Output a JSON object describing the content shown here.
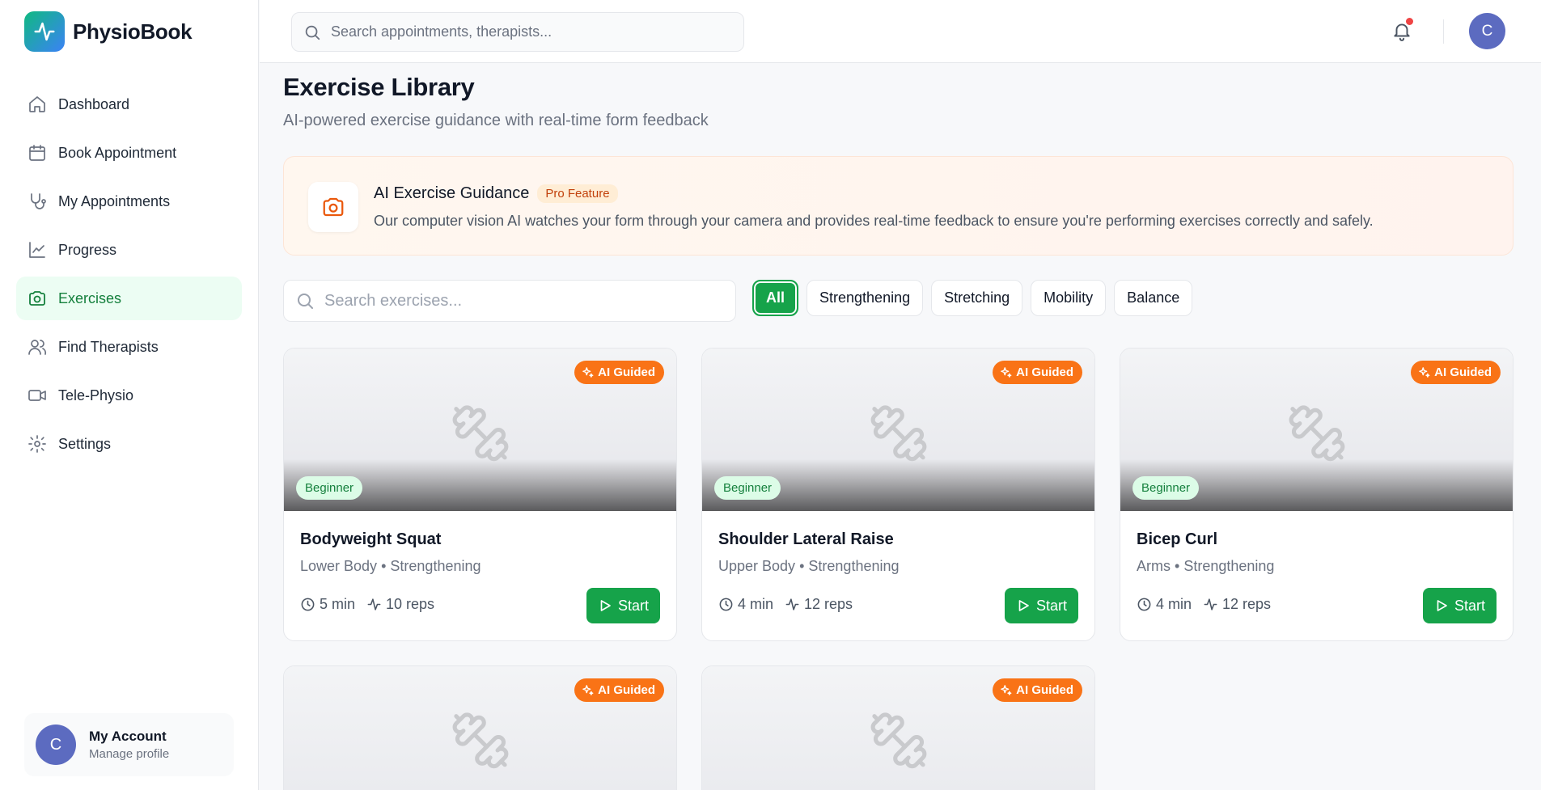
{
  "app": {
    "name": "PhysioBook"
  },
  "sidebar": {
    "items": [
      {
        "label": "Dashboard",
        "icon": "home-icon"
      },
      {
        "label": "Book Appointment",
        "icon": "calendar-icon"
      },
      {
        "label": "My Appointments",
        "icon": "stethoscope-icon"
      },
      {
        "label": "Progress",
        "icon": "chart-line-icon"
      },
      {
        "label": "Exercises",
        "icon": "camera-icon",
        "active": true
      },
      {
        "label": "Find Therapists",
        "icon": "users-icon"
      },
      {
        "label": "Tele-Physio",
        "icon": "video-icon"
      },
      {
        "label": "Settings",
        "icon": "gear-icon"
      }
    ],
    "account": {
      "initial": "C",
      "name": "My Account",
      "sub": "Manage profile"
    }
  },
  "header": {
    "search_placeholder": "Search appointments, therapists...",
    "avatar_initial": "C",
    "has_notification": true
  },
  "page": {
    "title": "Exercise Library",
    "subtitle": "AI-powered exercise guidance with real-time form feedback"
  },
  "banner": {
    "title": "AI Exercise Guidance",
    "badge": "Pro Feature",
    "description": "Our computer vision AI watches your form through your camera and provides real-time feedback to ensure you're performing exercises correctly and safely."
  },
  "filters": {
    "search_placeholder": "Search exercises...",
    "chips": [
      "All",
      "Strengthening",
      "Stretching",
      "Mobility",
      "Balance"
    ],
    "active": "All"
  },
  "cards": [
    {
      "title": "Bodyweight Squat",
      "area": "Lower Body",
      "category": "Strengthening",
      "duration": "5 min",
      "reps": "10 reps",
      "level": "Beginner",
      "badge": "AI Guided",
      "start": "Start"
    },
    {
      "title": "Shoulder Lateral Raise",
      "area": "Upper Body",
      "category": "Strengthening",
      "duration": "4 min",
      "reps": "12 reps",
      "level": "Beginner",
      "badge": "AI Guided",
      "start": "Start"
    },
    {
      "title": "Bicep Curl",
      "area": "Arms",
      "category": "Strengthening",
      "duration": "4 min",
      "reps": "12 reps",
      "level": "Beginner",
      "badge": "AI Guided",
      "start": "Start"
    },
    {
      "badge": "AI Guided"
    },
    {
      "badge": "AI Guided"
    }
  ],
  "colors": {
    "accent": "#16a34a",
    "ai_badge": "#f97316",
    "avatar": "#5c6bc0",
    "notification": "#ef4444"
  },
  "meta_separator": "•"
}
